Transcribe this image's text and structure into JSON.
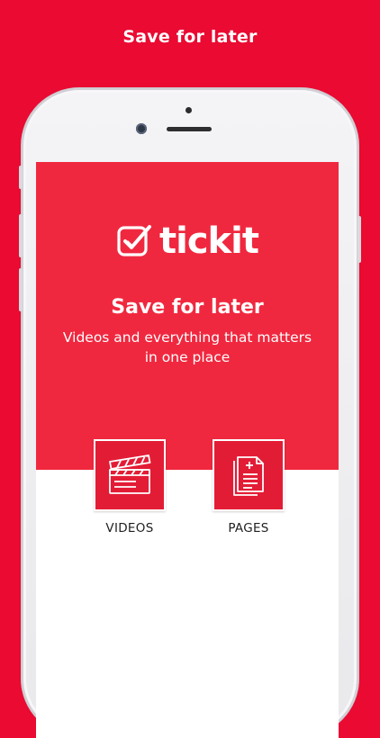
{
  "headline": "Save for later",
  "app": {
    "logo_text": "tickit",
    "title": "Save for later",
    "subtitle": "Videos and everything that matters in one place"
  },
  "categories": [
    {
      "label": "VIDEOS",
      "icon": "clapperboard-icon"
    },
    {
      "label": "PAGES",
      "icon": "pages-add-icon"
    }
  ],
  "colors": {
    "background": "#ea0a32",
    "brand_red": "#f0283f",
    "tile_red": "#e31c36",
    "screen_white": "#ffffff"
  }
}
